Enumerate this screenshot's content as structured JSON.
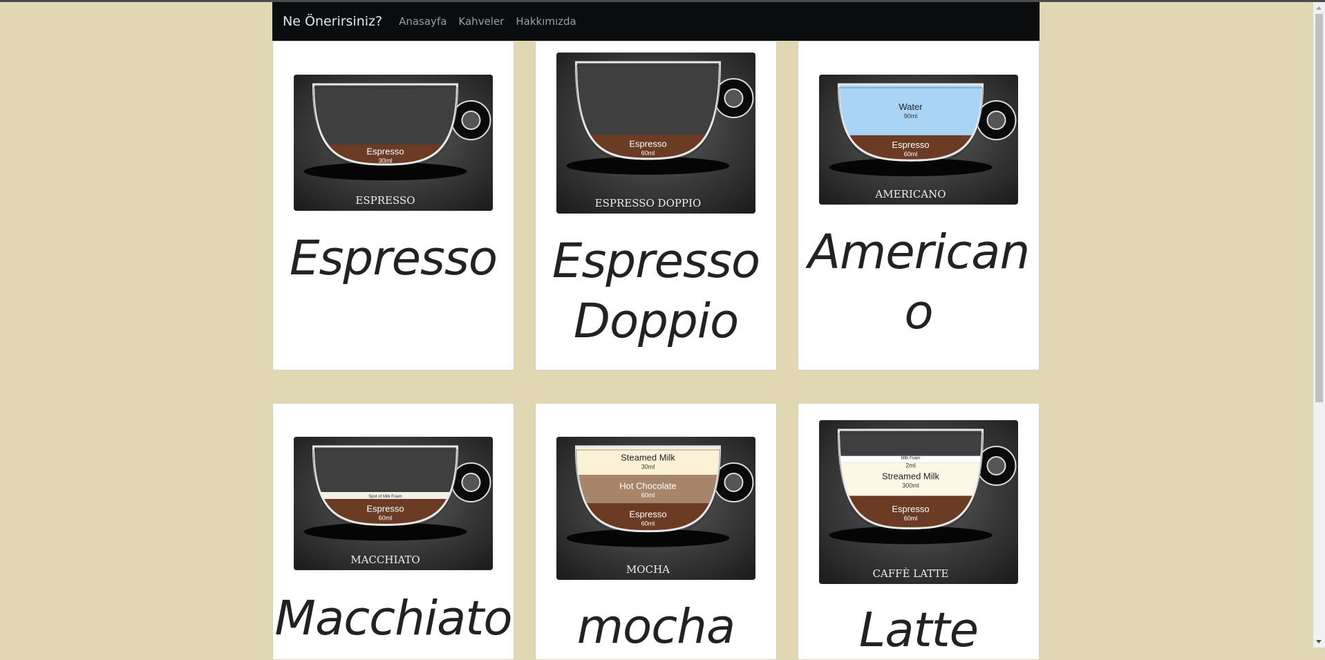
{
  "nav": {
    "brand": "Ne Önerirsiniz?",
    "links": [
      "Anasayfa",
      "Kahveler",
      "Hakkımızda"
    ]
  },
  "colors": {
    "page_bg": "#dfd8b3",
    "navbar_bg": "#0b0c0e",
    "coffee_brown": "#6b3b24",
    "card_bg": "#ffffff"
  },
  "cards": [
    {
      "title": "Espresso",
      "image": {
        "caption": "ESPRESSO",
        "layers": [
          {
            "label": "Espresso",
            "amount": "30ml",
            "color": "#6b3b24"
          }
        ]
      }
    },
    {
      "title": "Espresso Doppio",
      "image": {
        "caption": "ESPRESSO DOPPIO",
        "layers": [
          {
            "label": "Espresso",
            "amount": "60ml",
            "color": "#6b3b24"
          }
        ]
      }
    },
    {
      "title": "Americano",
      "image": {
        "caption": "AMERICANO",
        "layers": [
          {
            "label": "Espresso",
            "amount": "60ml",
            "color": "#6b3b24"
          },
          {
            "label": "Water",
            "amount": "90ml",
            "color": "#a9d4f5"
          }
        ]
      }
    },
    {
      "title": "Macchiato",
      "image": {
        "caption": "MACCHIATO",
        "layers": [
          {
            "label": "Espresso",
            "amount": "60ml",
            "color": "#6b3b24"
          },
          {
            "label": "Spot of Milk Foam",
            "amount": "",
            "color": "#f4f1ea"
          }
        ]
      }
    },
    {
      "title": "mocha",
      "image": {
        "caption": "MOCHA",
        "layers": [
          {
            "label": "Espresso",
            "amount": "60ml",
            "color": "#6b3b24"
          },
          {
            "label": "Hot Chocolate",
            "amount": "60ml",
            "color": "#a7856b"
          },
          {
            "label": "Steamed Milk",
            "amount": "30ml",
            "color": "#fbf1d6"
          }
        ]
      }
    },
    {
      "title": "Latte",
      "image": {
        "caption": "CAFFÈ LATTE",
        "layers": [
          {
            "label": "Espresso",
            "amount": "60ml",
            "color": "#6b3b24"
          },
          {
            "label": "Streamed Milk",
            "amount": "300ml",
            "color": "#fdf7e6"
          },
          {
            "label": "Milk Foam",
            "amount": "2ml",
            "color": "#ffffff"
          }
        ]
      }
    }
  ]
}
